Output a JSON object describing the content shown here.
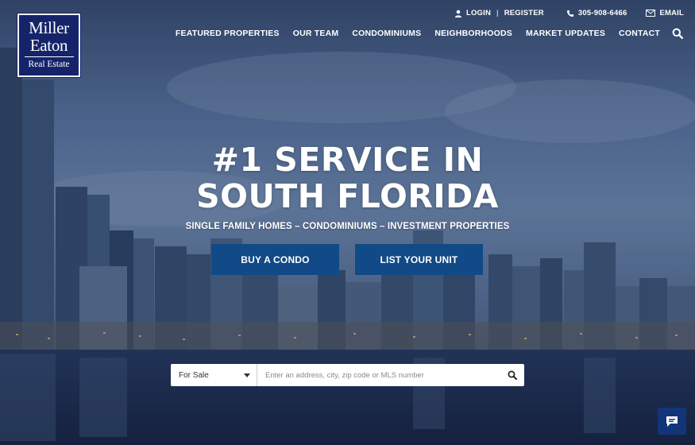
{
  "brand": {
    "line1": "Miller",
    "line2": "Eaton",
    "line3": "Real Estate"
  },
  "utility": {
    "login": "LOGIN",
    "separator": "|",
    "register": "REGISTER",
    "phone": "305-908-6466",
    "email": "EMAIL"
  },
  "nav": {
    "items": [
      {
        "label": "FEATURED PROPERTIES"
      },
      {
        "label": "OUR TEAM"
      },
      {
        "label": "CONDOMINIUMS"
      },
      {
        "label": "NEIGHBORHOODS"
      },
      {
        "label": "MARKET UPDATES"
      },
      {
        "label": "CONTACT"
      }
    ],
    "search_icon": "search-icon"
  },
  "hero": {
    "headline_line1": "#1 SERVICE IN",
    "headline_line2": "SOUTH FLORIDA",
    "subline": "SINGLE FAMILY HOMES – CONDOMINIUMS – INVESTMENT PROPERTIES",
    "cta_primary": "BUY A CONDO",
    "cta_secondary": "LIST YOUR UNIT"
  },
  "search": {
    "type_selected": "For Sale",
    "placeholder": "Enter an address, city, zip code or MLS number"
  },
  "colors": {
    "logo_bg": "#15246a",
    "cta_bg": "#114a86",
    "chat_bg": "#12357a"
  },
  "icons": {
    "user": "user-icon",
    "phone": "phone-icon",
    "email": "envelope-icon",
    "chat": "chat-icon"
  }
}
